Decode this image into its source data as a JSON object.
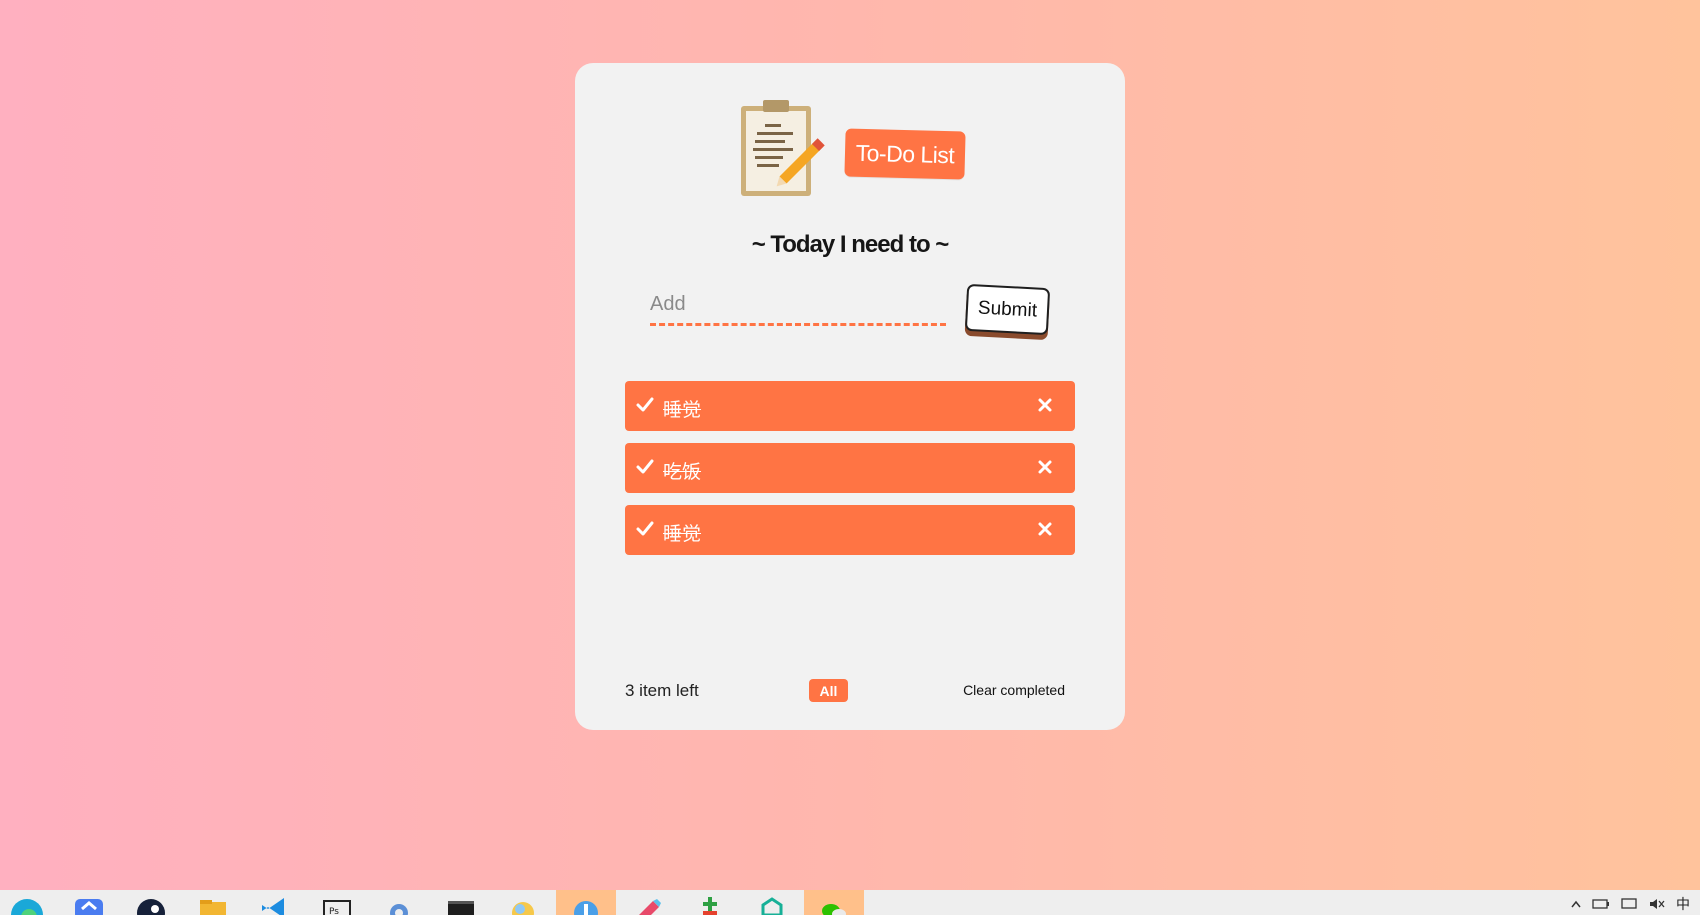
{
  "app": {
    "title": "To-Do List",
    "subtitle": "~ Today I need to ~"
  },
  "input": {
    "placeholder": "Add",
    "value": ""
  },
  "submit_label": "Submit",
  "todos": [
    {
      "text": "睡觉",
      "completed": true
    },
    {
      "text": "吃饭",
      "completed": true
    },
    {
      "text": "睡觉",
      "completed": true
    }
  ],
  "footer": {
    "count_text": "3 item left",
    "filter_all": "All",
    "clear_completed": "Clear completed"
  },
  "colors": {
    "accent": "#ff7444",
    "card": "#f2f2f2",
    "bg_left": "#ffb0c0",
    "bg_right": "#ffc39c"
  },
  "taskbar": {
    "icons": [
      "edge-icon",
      "app-store-icon",
      "steam-icon",
      "file-explorer-icon",
      "vscode-icon",
      "photo-app-icon",
      "settings-app-icon",
      "terminal-icon",
      "folder-app-icon",
      "media-app-icon",
      "paint-app-icon",
      "calculator-app-icon",
      "chat-app-icon",
      "wechat-icon"
    ],
    "tray_text": "中"
  }
}
